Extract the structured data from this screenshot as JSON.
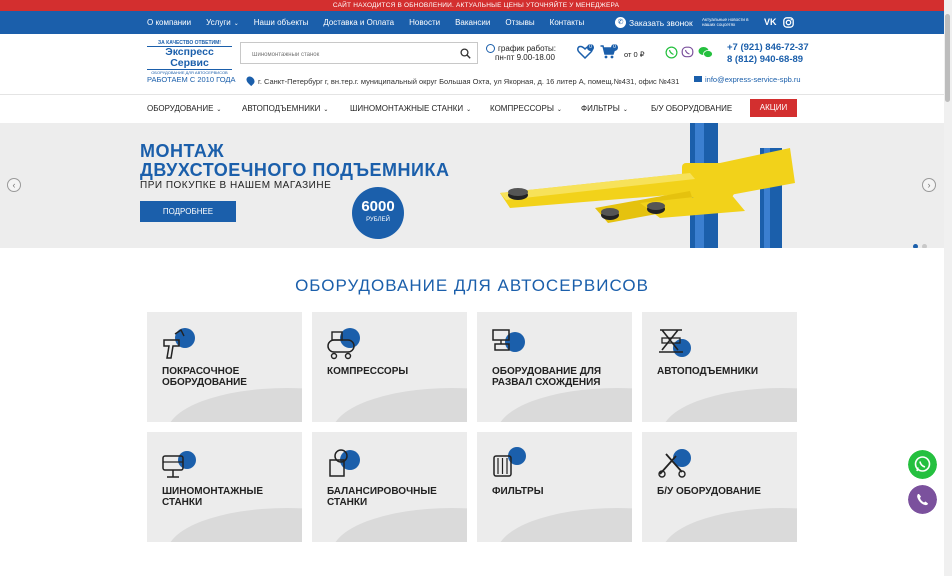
{
  "notice": "САЙТ НАХОДИТСЯ В ОБНОВЛЕНИИ. АКТУАЛЬНЫЕ ЦЕНЫ УТОЧНЯЙТЕ У МЕНЕДЖЕРА",
  "topnav": {
    "links": [
      "О компании",
      "Услуги",
      "Наши объекты",
      "Доставка и Оплата",
      "Новости",
      "Вакансии",
      "Отзывы",
      "Контакты"
    ],
    "callback": "Заказать звонок",
    "news_note": "Актуальные новости в наших соцсетях",
    "vk": "VK"
  },
  "logo": {
    "line1": "ЗА КАЧЕСТВО ОТВЕТИМ!",
    "line2": "Экспресс Сервис",
    "line3": "ОБОРУДОВАНИЕ ДЛЯ АВТОСЕРВИСОВ"
  },
  "search": {
    "placeholder": "Шиномонтажный станок"
  },
  "hours": {
    "label": "график работы:",
    "value": "пн-пт 9.00-18.00"
  },
  "cart": {
    "wishlist_count": "0",
    "cart_count": "0",
    "total": "от 0 ₽"
  },
  "phones": [
    "+7 (921) 846-72-37",
    "8 (812) 940-68-89"
  ],
  "since": "РАБОТАЕМ С 2010 ГОДА",
  "address": "г. Санкт-Петербург г, вн.тер.г. муниципальный округ Большая Охта, ул Якорная, д. 16 литер А, помещ.№431, офис №431",
  "email": "info@express-service-spb.ru",
  "catnav": {
    "items": [
      "ОБОРУДОВАНИЕ",
      "АВТОПОДЪЕМНИКИ",
      "ШИНОМОНТАЖНЫЕ СТАНКИ",
      "КОМПРЕССОРЫ",
      "ФИЛЬТРЫ",
      "Б/У ОБОРУДОВАНИЕ"
    ],
    "promo": "АКЦИИ"
  },
  "hero": {
    "title_line1": "МОНТАЖ",
    "title_line2": "ДВУХСТОЕЧНОГО ПОДЪЕМНИКА",
    "subtitle": "ПРИ ПОКУПКЕ В НАШЕМ МАГАЗИНЕ",
    "button": "ПОДРОБНЕЕ",
    "price_value": "6000",
    "price_unit": "РУБЛЕЙ",
    "slides": 2,
    "active_slide": 1
  },
  "section": {
    "title": "ОБОРУДОВАНИЕ ДЛЯ АВТОСЕРВИСОВ",
    "cards": [
      {
        "label": "ПОКРАСОЧНОЕ ОБОРУДОВАНИЕ",
        "icon": "spray-gun-icon"
      },
      {
        "label": "КОМПРЕССОРЫ",
        "icon": "compressor-icon"
      },
      {
        "label": "ОБОРУДОВАНИЕ ДЛЯ РАЗВАЛ СХОЖДЕНИЯ",
        "icon": "wheel-alignment-icon"
      },
      {
        "label": "АВТОПОДЪЕМНИКИ",
        "icon": "car-lift-icon"
      },
      {
        "label": "ШИНОМОНТАЖНЫЕ СТАНКИ",
        "icon": "tire-changer-icon"
      },
      {
        "label": "БАЛАНСИРОВОЧНЫЕ СТАНКИ",
        "icon": "balancer-icon"
      },
      {
        "label": "ФИЛЬТРЫ",
        "icon": "filter-icon"
      },
      {
        "label": "Б/У ОБОРУДОВАНИЕ",
        "icon": "used-equipment-icon"
      }
    ]
  },
  "colors": {
    "brand": "#1b5fab",
    "accent": "#d32f2f",
    "whatsapp": "#25c03f",
    "viber": "#7b519d"
  }
}
